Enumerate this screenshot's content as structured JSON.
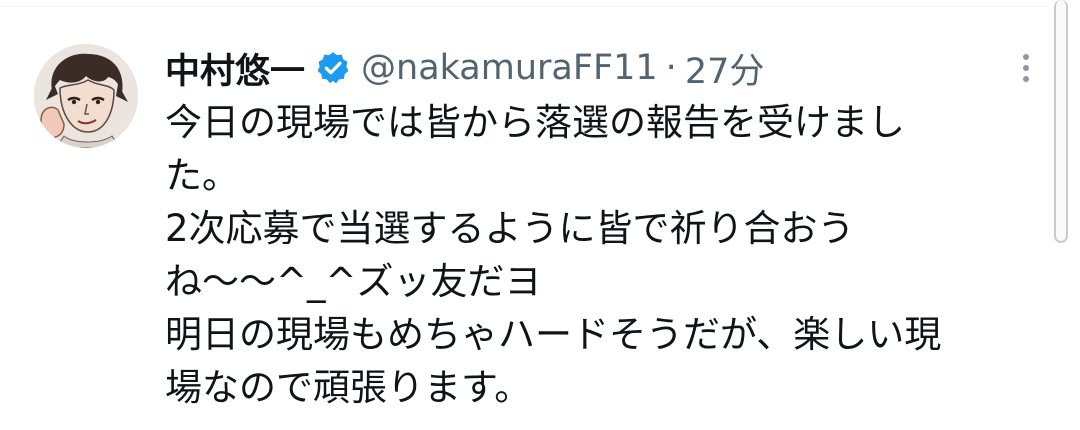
{
  "tweet": {
    "author_name": "中村悠一",
    "verified_icon": "verified-badge-icon",
    "handle": "@nakamuraFF11",
    "separator": "·",
    "time": "27分",
    "more_icon": "more-vertical-icon",
    "avatar_icon": "user-avatar-illustration",
    "body_lines": [
      "今日の現場では皆から落選の報告を受けまし",
      "た。",
      "2次応募で当選するように皆で祈り合おう",
      "ね〜〜^_^ズッ友だヨ",
      "明日の現場もめちゃハードそうだが、楽しい現",
      "場なので頑張ります。"
    ]
  },
  "colors": {
    "text_primary": "#0f1419",
    "text_secondary": "#536471",
    "verified_blue": "#1d9bf0"
  }
}
